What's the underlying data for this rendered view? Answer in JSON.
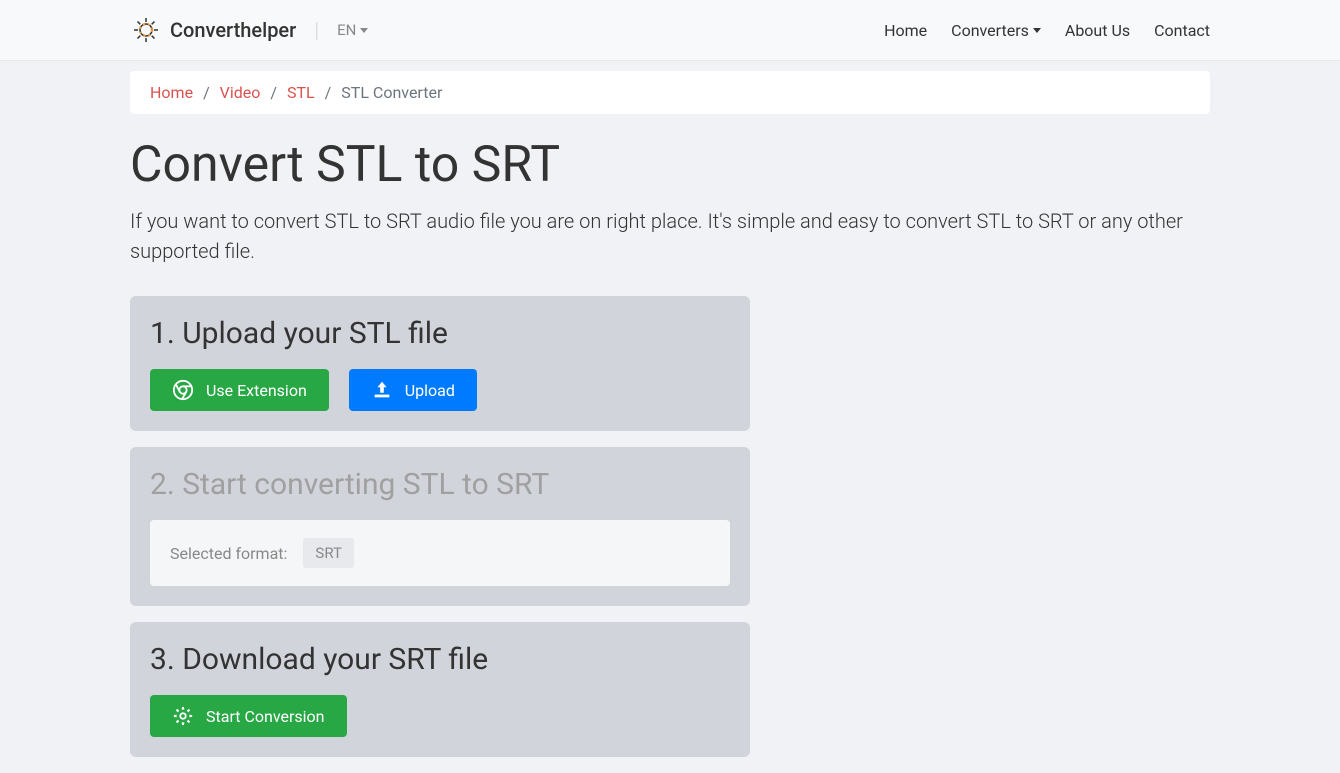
{
  "header": {
    "brand": "Converthelper",
    "lang": "EN",
    "nav": {
      "home": "Home",
      "converters": "Converters",
      "about": "About Us",
      "contact": "Contact"
    }
  },
  "breadcrumb": {
    "home": "Home",
    "video": "Video",
    "stl": "STL",
    "current": "STL Converter"
  },
  "page": {
    "title": "Convert STL to SRT",
    "subtitle": "If you want to convert STL to SRT audio file you are on right place. It's simple and easy to convert STL to SRT or any other supported file."
  },
  "step1": {
    "title": "1. Upload your STL file",
    "extension_btn": "Use Extension",
    "upload_btn": "Upload"
  },
  "step2": {
    "title": "2. Start converting STL to SRT",
    "format_label": "Selected format:",
    "format_value": "SRT"
  },
  "step3": {
    "title": "3. Download your SRT file",
    "start_btn": "Start Conversion"
  }
}
